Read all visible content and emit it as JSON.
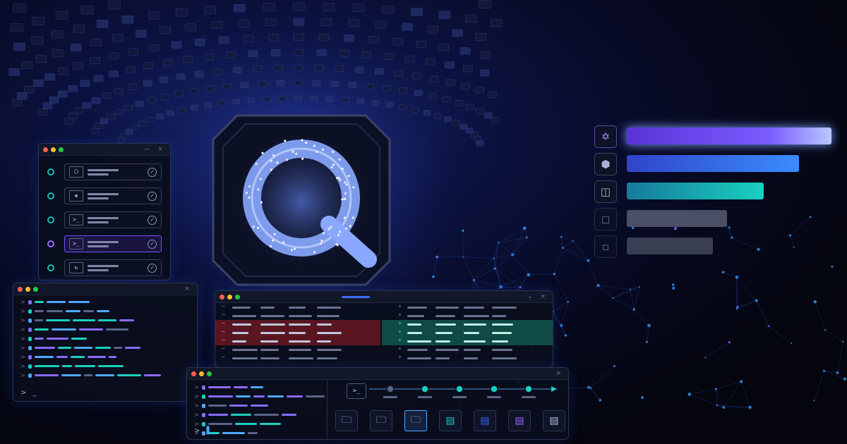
{
  "colors": {
    "background": "#05060f",
    "accent_blue": "#3b6cff",
    "accent_purple": "#7a4dff",
    "accent_teal": "#1ad0c0",
    "diff_removed": "#5a1620",
    "diff_added": "#0f4a45"
  },
  "logo": {
    "letter": "Q",
    "icon": "q-shield-logo"
  },
  "ranking_bars": [
    {
      "icon": "star-of-david-icon",
      "level": 1.0,
      "color": "#7a4dff"
    },
    {
      "icon": "hexagon-gear-icon",
      "level": 0.84,
      "color": "#3b5cff"
    },
    {
      "icon": "cube-icon",
      "level": 0.67,
      "color": "#1ab8b0"
    },
    {
      "icon": "cube-outline-icon",
      "level": 0.49,
      "color": "#4a4f66"
    },
    {
      "icon": "cube-faded-icon",
      "level": 0.42,
      "color": "#3a3e52"
    }
  ],
  "pipeline": {
    "step_icons": [
      "cube-icon",
      "diamond-icon",
      "terminal-icon",
      "terminal-icon",
      "cycle-icon"
    ],
    "active_index": 3,
    "terminal_symbol": ">_"
  },
  "terminal": {
    "prompt": ">",
    "cursor": "_"
  },
  "bottom_terminal": {
    "prompt": ">",
    "cursor": "▌_"
  },
  "timeline": {
    "terminal_symbol": ">_",
    "node_count": 5
  },
  "file_icons": [
    "folder-icon",
    "folder-icon",
    "folder-icon",
    "doc-teal-icon",
    "doc-blue-icon",
    "doc-purple-icon",
    "doc-gray-icon"
  ]
}
